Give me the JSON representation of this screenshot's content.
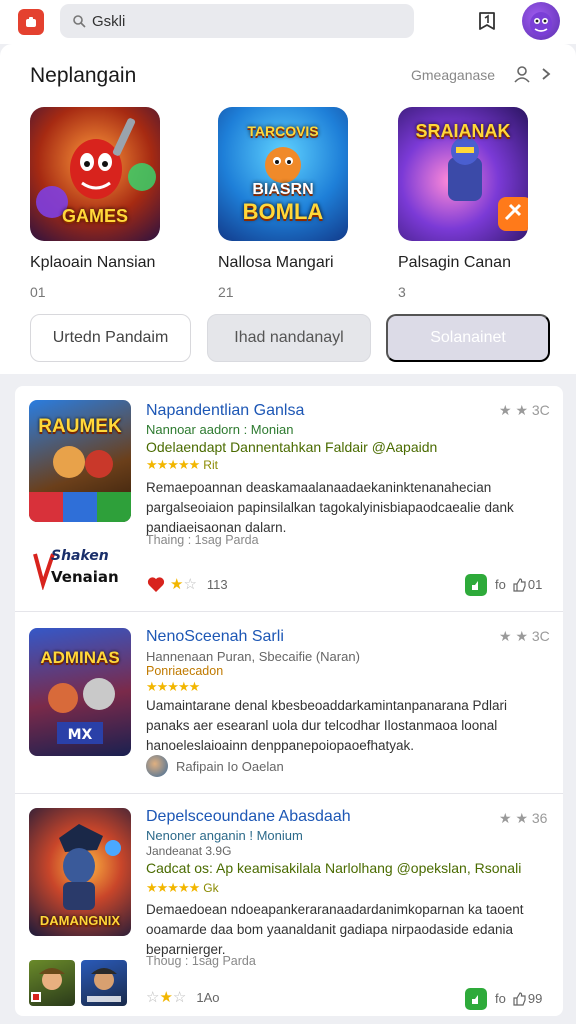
{
  "colors": {
    "accent": "#e4412f",
    "link": "#1d57b5",
    "green": "#2eaa3a",
    "star": "#f2b600"
  },
  "topbar": {
    "search_value": "Gskli",
    "icons": [
      "app-logo-icon",
      "search-icon",
      "bookmark-icon",
      "avatar"
    ]
  },
  "featured": {
    "title": "Neplangain",
    "more_label": "Gmeaganase",
    "games": [
      {
        "name": "Kplaoain Nansian",
        "count": "01",
        "art_text": "GAMES"
      },
      {
        "name": "Nallosa Mangari",
        "count": "21",
        "art_text": "TARCOVIS BIASRN BOMLA"
      },
      {
        "name": "Palsagin Canan",
        "count": "3",
        "art_text": "SRAIANAK"
      }
    ],
    "pills": [
      "Urtedn Pandaim",
      "Ihad nandanayl",
      "Solanainet"
    ]
  },
  "list": [
    {
      "art_text": "RAUMEK",
      "title": "Napandentlian Ganlsa",
      "sub": "Nannoar aadorn : Monian",
      "tag": "Odelaendapt Dannentahkan Faldair @Aapaidn",
      "stars": "★★★★★",
      "score": "Rit",
      "desc": "Remaepoannan deaskamaalanaadaekaninktenanahecian pargalseoiaion papinsilalkan tagokalyinisbiapaodcaealie dank pandiaeisaonan dalarn.",
      "meta": "Thaing : 1sag Parda",
      "dev_logo": "Shaken Venaian",
      "rating_top": "★ ★ 3C",
      "likes_count": "113",
      "right_count": "fo",
      "right_count2": "01"
    },
    {
      "art_text": "ADMINAS",
      "title": "NenoSceenah Sarli",
      "sub": "Hannenaan Puran, Sbecaifie (Naran)",
      "tag": "Ponriaecadon",
      "stars": "★★★★★",
      "desc": "Uamaintarane denal kbesbeoaddarkamintanpanarana Pdlari panaks aer esearanl uola dur telcodhar Ilostanmaoa loonal hanoeleslaioainn denppanepoiopaoefhatyak.",
      "author": "Rafipain Io Oaelan",
      "rating_top": "★ ★ 3C"
    },
    {
      "art_text": "DAMANGNIX",
      "title": "Depelsceoundane Abasdaah",
      "sub": "Nenoner anganin ! Monium",
      "sub2": "Jandeanat 3.9G",
      "tag": "Cadcat os: Ap keamisakilala Narlolhang @opekslan, Rsonali",
      "stars": "★★★★★",
      "score": "Gk",
      "desc": "Demaedoean ndoeapankeraranaadardanimkoparnan ka taoent ooamarde daa bom yaanaldanit gadiapa nirpaodaside edania beparnierger.",
      "meta": "Thoug : 1sag Parda",
      "rating_top": "★ ★ 36",
      "likes_count": "1Ao",
      "right_count": "fo",
      "right_count2": "99"
    }
  ]
}
